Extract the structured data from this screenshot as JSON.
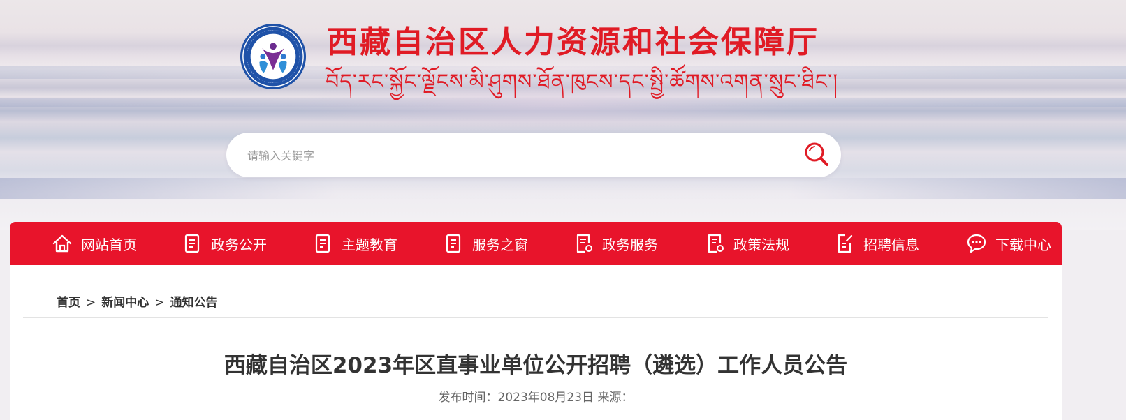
{
  "header": {
    "title_cn": "西藏自治区人力资源和社会保障厅",
    "title_bo": "བོད་རང་སྐྱོང་ལྗོངས་མི་ཤུགས་ཐོན་ཁུངས་དང་སྤྱི་ཚོགས་འགན་སྲུང་ཐིང་།"
  },
  "search": {
    "placeholder": "请输入关键字",
    "value": ""
  },
  "nav": {
    "items": [
      {
        "label": "网站首页",
        "icon": "home-icon"
      },
      {
        "label": "政务公开",
        "icon": "document-icon"
      },
      {
        "label": "主题教育",
        "icon": "document-icon"
      },
      {
        "label": "服务之窗",
        "icon": "document-icon"
      },
      {
        "label": "政务服务",
        "icon": "document-settings-icon"
      },
      {
        "label": "政策法规",
        "icon": "document-settings-icon"
      },
      {
        "label": "招聘信息",
        "icon": "edit-document-icon"
      },
      {
        "label": "下载中心",
        "icon": "chat-icon"
      }
    ]
  },
  "breadcrumb": {
    "items": [
      "首页",
      "新闻中心",
      "通知公告"
    ],
    "separator": ">"
  },
  "article": {
    "title": "西藏自治区2023年区直事业单位公开招聘（遴选）工作人员公告",
    "meta": "发布时间：2023年08月23日 来源："
  },
  "colors": {
    "accent": "#e8142b",
    "title_red": "#e01b25"
  }
}
